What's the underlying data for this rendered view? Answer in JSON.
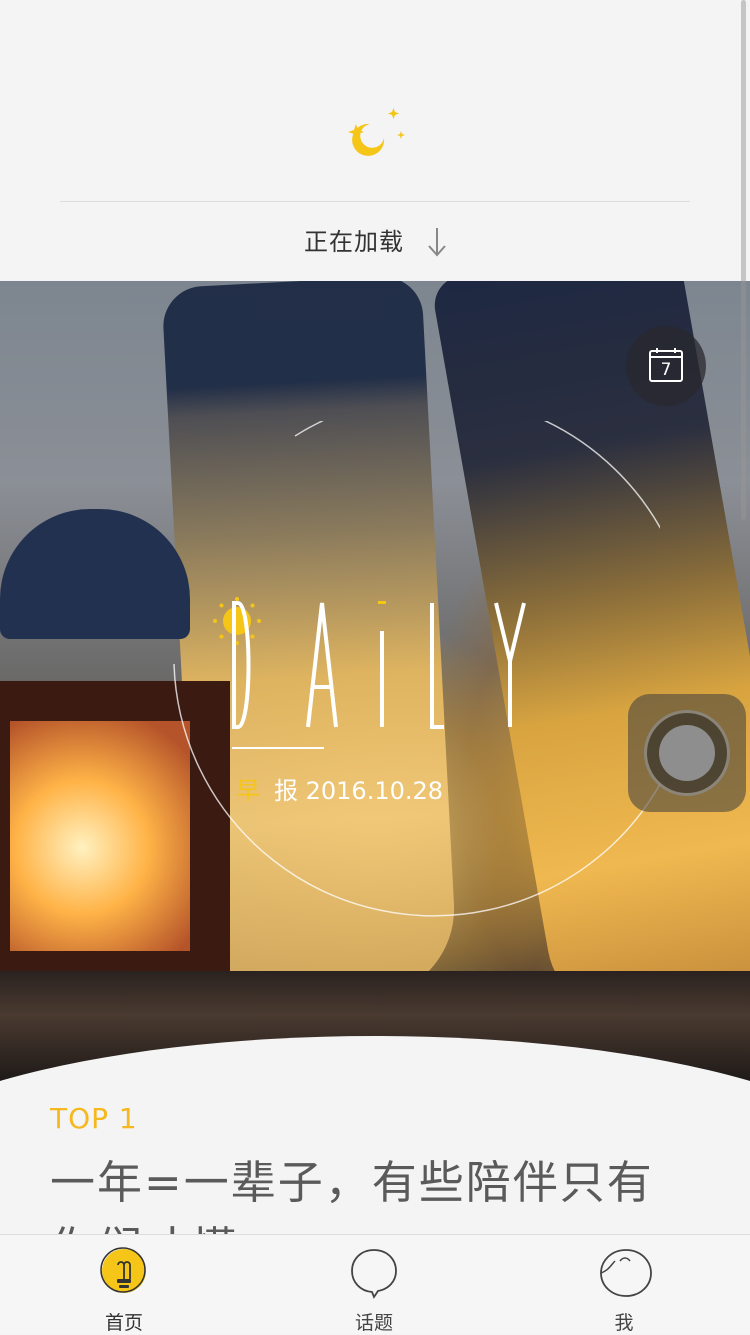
{
  "refresh": {
    "status_text": "正在加载"
  },
  "hero": {
    "calendar_day": "7",
    "title": "DAiLY",
    "date_prefix": "早",
    "date_text": "报 2016.10.28"
  },
  "article": {
    "top_label": "TOP 1",
    "title": "一年=一辈子，有些陪伴只有你们才懂"
  },
  "tabbar": {
    "tabs": [
      {
        "label": "首页",
        "active": true
      },
      {
        "label": "话题",
        "active": false
      },
      {
        "label": "我",
        "active": false
      }
    ]
  },
  "colors": {
    "accent": "#f5c518",
    "tab_active": "#f5c518"
  }
}
